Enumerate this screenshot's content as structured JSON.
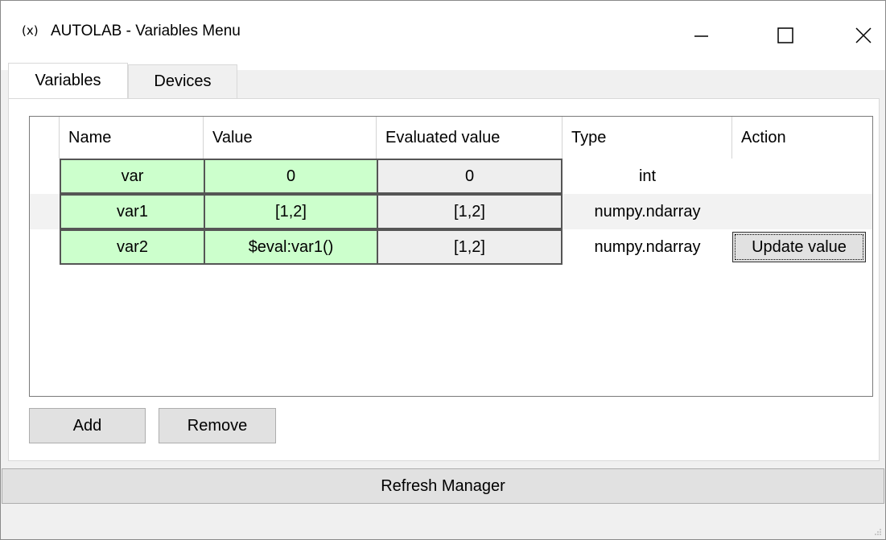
{
  "window": {
    "icon_text": "(x)",
    "title": "AUTOLAB - Variables Menu"
  },
  "tabs": [
    {
      "label": "Variables",
      "selected": true
    },
    {
      "label": "Devices",
      "selected": false
    }
  ],
  "table": {
    "headers": [
      "Name",
      "Value",
      "Evaluated value",
      "Type",
      "Action"
    ],
    "rows": [
      {
        "name": "var",
        "value": "0",
        "evaluated": "0",
        "type": "int",
        "action": ""
      },
      {
        "name": "var1",
        "value": "[1,2]",
        "evaluated": "[1,2]",
        "type": "numpy.ndarray",
        "action": ""
      },
      {
        "name": "var2",
        "value": "$eval:var1()",
        "evaluated": "[1,2]",
        "type": "numpy.ndarray",
        "action": "Update value"
      }
    ]
  },
  "buttons": {
    "add": "Add",
    "remove": "Remove",
    "refresh": "Refresh Manager"
  },
  "colors": {
    "editable_cell": "#ccffcc",
    "readonly_cell": "#eeeeee"
  }
}
